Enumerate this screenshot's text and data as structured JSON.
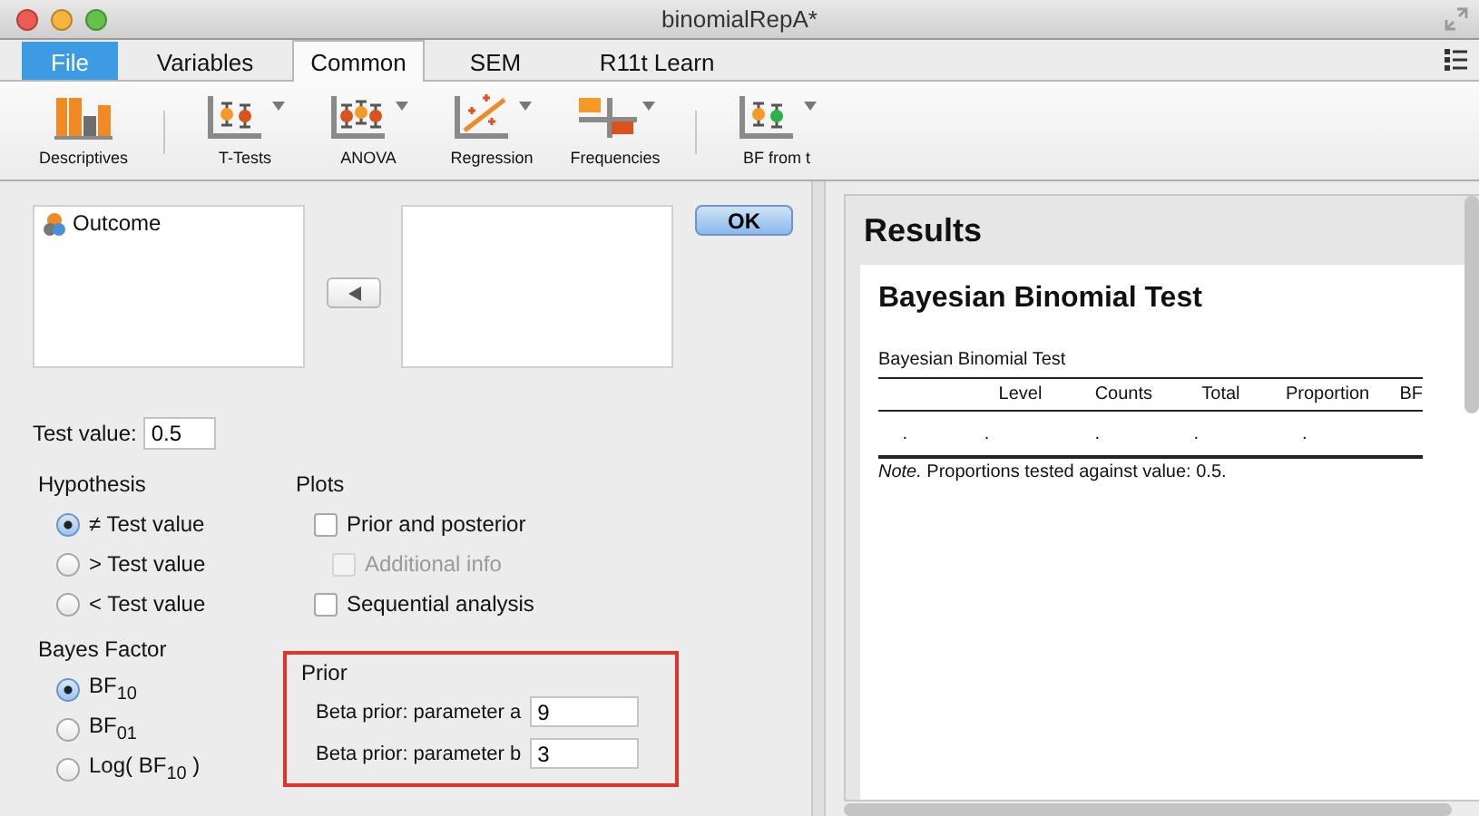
{
  "window": {
    "title": "binomialRepA*"
  },
  "tabs": [
    {
      "label": "File",
      "kind": "file",
      "selected": false
    },
    {
      "label": "Variables",
      "kind": "ribbon",
      "selected": false
    },
    {
      "label": "Common",
      "kind": "ribbon",
      "selected": true
    },
    {
      "label": "SEM",
      "kind": "ribbon",
      "selected": false
    },
    {
      "label": "R11t Learn",
      "kind": "ribbon",
      "selected": false
    }
  ],
  "toolbar": {
    "groups": [
      {
        "buttons": [
          {
            "label": "Descriptives",
            "kind": "bars",
            "dropdown": false
          }
        ]
      },
      {
        "buttons": [
          {
            "label": "T-Tests",
            "kind": "ttest",
            "dropdown": true
          },
          {
            "label": "ANOVA",
            "kind": "anova",
            "dropdown": true
          },
          {
            "label": "Regression",
            "kind": "regression",
            "dropdown": true
          },
          {
            "label": "Frequencies",
            "kind": "frequencies",
            "dropdown": true
          }
        ]
      },
      {
        "buttons": [
          {
            "label": "BF from t",
            "kind": "bf",
            "dropdown": true
          }
        ]
      }
    ]
  },
  "analysis": {
    "source_variables": [
      {
        "name": "Outcome"
      }
    ],
    "ok_button": "OK",
    "test_value": {
      "label": "Test value:",
      "value": "0.5"
    },
    "hypothesis": {
      "title": "Hypothesis",
      "options": [
        {
          "label": "≠ Test value",
          "selected": true
        },
        {
          "label": "> Test value",
          "selected": false
        },
        {
          "label": "< Test value",
          "selected": false
        }
      ]
    },
    "plots": {
      "title": "Plots",
      "options": [
        {
          "label": "Prior and posterior",
          "checked": false,
          "disabled": false,
          "children": [
            {
              "label": "Additional info",
              "checked": false,
              "disabled": true
            }
          ]
        },
        {
          "label": "Sequential analysis",
          "checked": false,
          "disabled": false
        }
      ]
    },
    "bayes_factor": {
      "title": "Bayes Factor",
      "options": [
        {
          "label": "BF$_{10}$",
          "selected": true
        },
        {
          "label": "BF$_{01}$",
          "selected": false
        },
        {
          "label": "Log( BF$_{10}$ )",
          "selected": false
        }
      ]
    },
    "prior": {
      "title": "Prior",
      "fields": [
        {
          "label": "Beta prior: parameter a",
          "value": "9"
        },
        {
          "label": "Beta prior: parameter b",
          "value": "3"
        }
      ]
    }
  },
  "results": {
    "title": "Results",
    "analysis_title": "Bayesian Binomial Test",
    "table": {
      "caption": "Bayesian Binomial Test",
      "columns": [
        "",
        "Level",
        "Counts",
        "Total",
        "Proportion",
        "BF"
      ],
      "rows": [
        [
          ".",
          ".",
          ".",
          ".",
          "."
        ]
      ],
      "note": "*Note.* Proportions tested against value: 0.5."
    }
  }
}
